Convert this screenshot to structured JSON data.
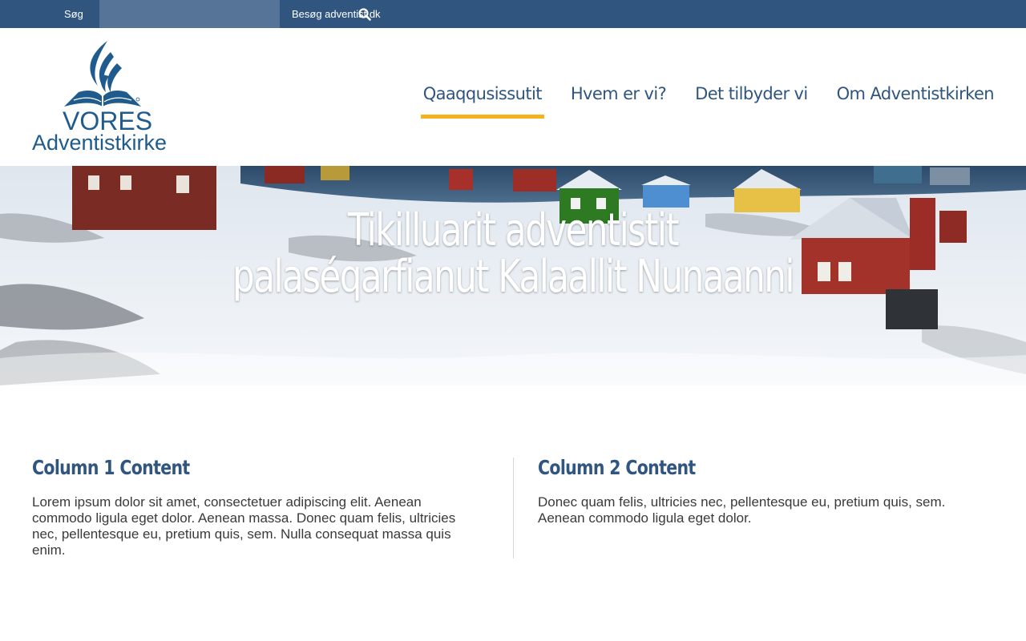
{
  "topbar": {
    "search_label": "Søg",
    "search_placeholder": "",
    "search_icon": "search-icon",
    "visit_link": "Besøg adventist.dk"
  },
  "header": {
    "logo": {
      "line1": "VORES",
      "line2": "Adventistkirke"
    },
    "nav": [
      {
        "label": "Qaaqqusissutit",
        "active": true
      },
      {
        "label": "Hvem er vi?",
        "active": false
      },
      {
        "label": "Det tilbyder vi",
        "active": false
      },
      {
        "label": "Om Adventistkirken",
        "active": false
      }
    ]
  },
  "hero": {
    "title_line1": "Tikilluarit adventistit",
    "title_line2": "palaséqarfianut Kalaallit Nunaanni"
  },
  "columns": [
    {
      "title": "Column 1 Content",
      "text": "Lorem ipsum dolor sit amet, consectetuer adipiscing elit. Aenean commodo ligula eget dolor. Aenean massa. Donec quam felis, ultricies nec, pellentesque eu, pretium quis, sem. Nulla consequat massa quis enim."
    },
    {
      "title": "Column 2 Content",
      "text": "Donec quam felis, ultricies nec, pellentesque eu, pretium quis, sem. Aenean commodo ligula eget dolor."
    }
  ],
  "colors": {
    "brand_blue": "#30557f",
    "accent_yellow": "#f6b21c",
    "logo_blue": "#1f5b8d"
  }
}
